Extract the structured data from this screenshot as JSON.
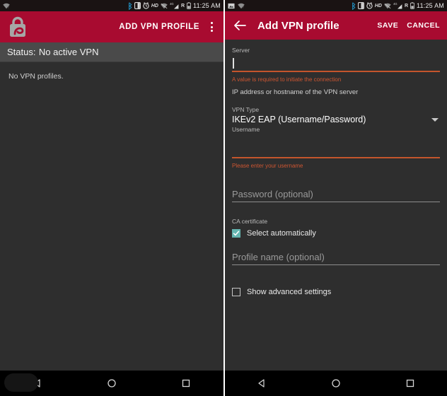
{
  "theme": {
    "accent_red": "#a80b30",
    "error_orange": "#cc5531",
    "checkbox_teal": "#64b5b0",
    "background": "#2e2e2e",
    "status_band": "#4a4a4a"
  },
  "left_screen": {
    "statusbar": {
      "left_icons": [
        "wifi-no-internet-icon"
      ],
      "right_icons": [
        "bluetooth-icon",
        "vibrate-icon",
        "alarm-icon",
        "hd-icon",
        "wifi-off-icon",
        "signal-4g-icon",
        "roaming-icon",
        "battery-icon"
      ],
      "hd_label": "HD",
      "network_label": "4G",
      "roaming_label": "R",
      "clock": "11:25 AM"
    },
    "appbar": {
      "logo_icon": "strongswan-padlock-logo",
      "action_label": "ADD VPN PROFILE",
      "overflow_icon": "overflow-menu-icon"
    },
    "status_band": {
      "label": "Status:",
      "value": "No active VPN"
    },
    "empty_message": "No VPN profiles."
  },
  "right_screen": {
    "statusbar": {
      "left_icons": [
        "screenshot-icon",
        "wifi-no-internet-icon"
      ],
      "right_icons": [
        "bluetooth-icon",
        "vibrate-icon",
        "alarm-icon",
        "hd-icon",
        "wifi-off-icon",
        "signal-4g-icon",
        "roaming-icon",
        "battery-icon"
      ],
      "hd_label": "HD",
      "network_label": "4G",
      "roaming_label": "R",
      "clock": "11:25 AM"
    },
    "appbar": {
      "back_icon": "back-arrow-icon",
      "title": "Add VPN profile",
      "save_label": "SAVE",
      "cancel_label": "CANCEL"
    },
    "form": {
      "server": {
        "label": "Server",
        "value": "",
        "placeholder": "",
        "error": "A value is required to initiate the connection",
        "help": "IP address or hostname of the VPN server"
      },
      "vpn_type": {
        "label": "VPN Type",
        "selected": "IKEv2 EAP (Username/Password)",
        "chevron_icon": "chevron-down-icon"
      },
      "username": {
        "label": "Username",
        "value": "",
        "error": "Please enter your username"
      },
      "password": {
        "placeholder": "Password (optional)",
        "value": ""
      },
      "ca_certificate": {
        "label": "CA certificate",
        "checkbox_label": "Select automatically",
        "checked": true
      },
      "profile_name": {
        "placeholder": "Profile name (optional)",
        "value": ""
      },
      "advanced": {
        "checkbox_label": "Show advanced settings",
        "checked": false
      }
    }
  },
  "navbar": {
    "back_icon": "nav-back-triangle-icon",
    "home_icon": "nav-home-circle-icon",
    "recents_icon": "nav-recents-square-icon"
  }
}
